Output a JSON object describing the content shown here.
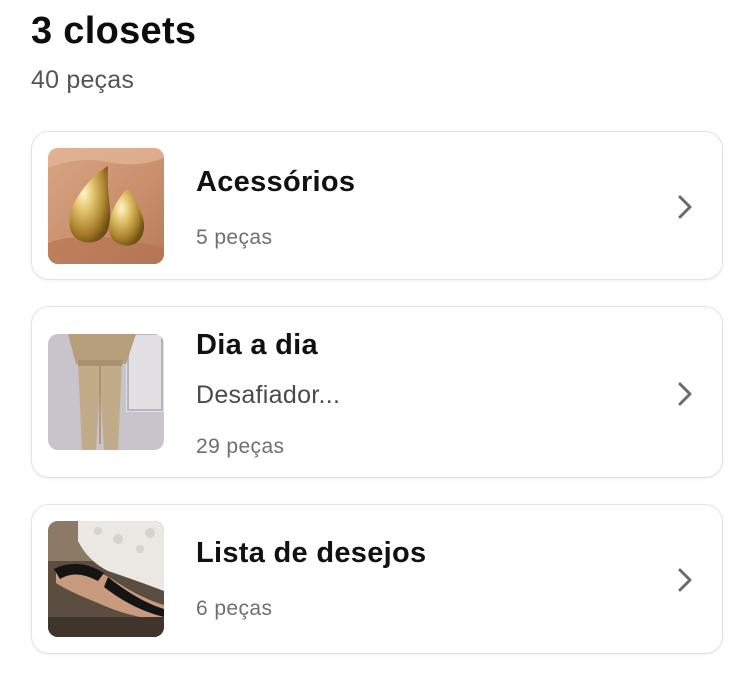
{
  "header": {
    "title": "3 closets",
    "subtitle": "40 peças"
  },
  "closets": [
    {
      "name": "Acessórios",
      "description": "",
      "count": "5 peças",
      "thumbnail_icon": "gold-earrings-photo"
    },
    {
      "name": "Dia a dia",
      "description": "Desafiador...",
      "count": "29 peças",
      "thumbnail_icon": "beige-suit-photo"
    },
    {
      "name": "Lista de desejos",
      "description": "",
      "count": "6 peças",
      "thumbnail_icon": "black-sandals-photo"
    }
  ],
  "icons": {
    "chevron": "chevron-right-icon"
  },
  "colors": {
    "title": "#0d0d0d",
    "secondary_text": "#6f6f6f",
    "card_border": "#e3e3e3",
    "chevron": "#6b6b6b"
  }
}
